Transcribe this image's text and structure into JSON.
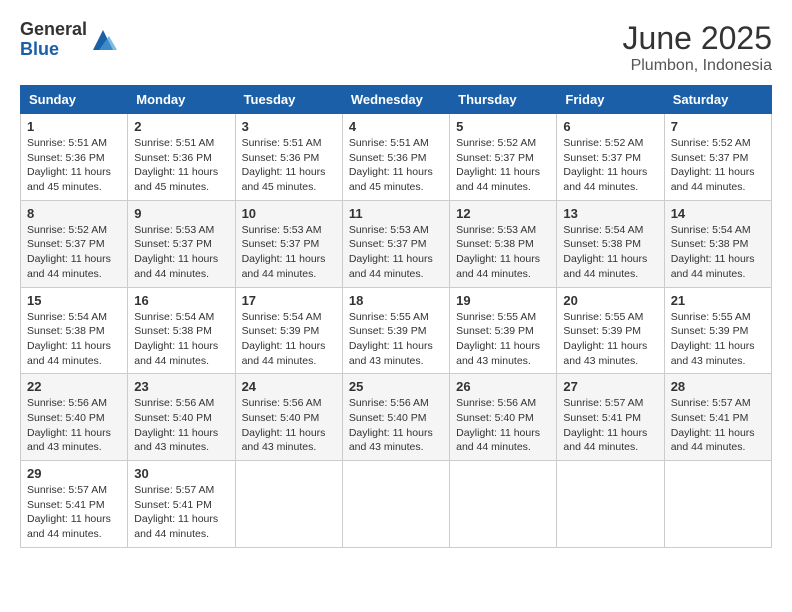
{
  "header": {
    "logo_general": "General",
    "logo_blue": "Blue",
    "month": "June 2025",
    "location": "Plumbon, Indonesia"
  },
  "weekdays": [
    "Sunday",
    "Monday",
    "Tuesday",
    "Wednesday",
    "Thursday",
    "Friday",
    "Saturday"
  ],
  "weeks": [
    [
      {
        "day": "1",
        "sunrise": "5:51 AM",
        "sunset": "5:36 PM",
        "daylight": "11 hours and 45 minutes."
      },
      {
        "day": "2",
        "sunrise": "5:51 AM",
        "sunset": "5:36 PM",
        "daylight": "11 hours and 45 minutes."
      },
      {
        "day": "3",
        "sunrise": "5:51 AM",
        "sunset": "5:36 PM",
        "daylight": "11 hours and 45 minutes."
      },
      {
        "day": "4",
        "sunrise": "5:51 AM",
        "sunset": "5:36 PM",
        "daylight": "11 hours and 45 minutes."
      },
      {
        "day": "5",
        "sunrise": "5:52 AM",
        "sunset": "5:37 PM",
        "daylight": "11 hours and 44 minutes."
      },
      {
        "day": "6",
        "sunrise": "5:52 AM",
        "sunset": "5:37 PM",
        "daylight": "11 hours and 44 minutes."
      },
      {
        "day": "7",
        "sunrise": "5:52 AM",
        "sunset": "5:37 PM",
        "daylight": "11 hours and 44 minutes."
      }
    ],
    [
      {
        "day": "8",
        "sunrise": "5:52 AM",
        "sunset": "5:37 PM",
        "daylight": "11 hours and 44 minutes."
      },
      {
        "day": "9",
        "sunrise": "5:53 AM",
        "sunset": "5:37 PM",
        "daylight": "11 hours and 44 minutes."
      },
      {
        "day": "10",
        "sunrise": "5:53 AM",
        "sunset": "5:37 PM",
        "daylight": "11 hours and 44 minutes."
      },
      {
        "day": "11",
        "sunrise": "5:53 AM",
        "sunset": "5:37 PM",
        "daylight": "11 hours and 44 minutes."
      },
      {
        "day": "12",
        "sunrise": "5:53 AM",
        "sunset": "5:38 PM",
        "daylight": "11 hours and 44 minutes."
      },
      {
        "day": "13",
        "sunrise": "5:54 AM",
        "sunset": "5:38 PM",
        "daylight": "11 hours and 44 minutes."
      },
      {
        "day": "14",
        "sunrise": "5:54 AM",
        "sunset": "5:38 PM",
        "daylight": "11 hours and 44 minutes."
      }
    ],
    [
      {
        "day": "15",
        "sunrise": "5:54 AM",
        "sunset": "5:38 PM",
        "daylight": "11 hours and 44 minutes."
      },
      {
        "day": "16",
        "sunrise": "5:54 AM",
        "sunset": "5:38 PM",
        "daylight": "11 hours and 44 minutes."
      },
      {
        "day": "17",
        "sunrise": "5:54 AM",
        "sunset": "5:39 PM",
        "daylight": "11 hours and 44 minutes."
      },
      {
        "day": "18",
        "sunrise": "5:55 AM",
        "sunset": "5:39 PM",
        "daylight": "11 hours and 43 minutes."
      },
      {
        "day": "19",
        "sunrise": "5:55 AM",
        "sunset": "5:39 PM",
        "daylight": "11 hours and 43 minutes."
      },
      {
        "day": "20",
        "sunrise": "5:55 AM",
        "sunset": "5:39 PM",
        "daylight": "11 hours and 43 minutes."
      },
      {
        "day": "21",
        "sunrise": "5:55 AM",
        "sunset": "5:39 PM",
        "daylight": "11 hours and 43 minutes."
      }
    ],
    [
      {
        "day": "22",
        "sunrise": "5:56 AM",
        "sunset": "5:40 PM",
        "daylight": "11 hours and 43 minutes."
      },
      {
        "day": "23",
        "sunrise": "5:56 AM",
        "sunset": "5:40 PM",
        "daylight": "11 hours and 43 minutes."
      },
      {
        "day": "24",
        "sunrise": "5:56 AM",
        "sunset": "5:40 PM",
        "daylight": "11 hours and 43 minutes."
      },
      {
        "day": "25",
        "sunrise": "5:56 AM",
        "sunset": "5:40 PM",
        "daylight": "11 hours and 43 minutes."
      },
      {
        "day": "26",
        "sunrise": "5:56 AM",
        "sunset": "5:40 PM",
        "daylight": "11 hours and 44 minutes."
      },
      {
        "day": "27",
        "sunrise": "5:57 AM",
        "sunset": "5:41 PM",
        "daylight": "11 hours and 44 minutes."
      },
      {
        "day": "28",
        "sunrise": "5:57 AM",
        "sunset": "5:41 PM",
        "daylight": "11 hours and 44 minutes."
      }
    ],
    [
      {
        "day": "29",
        "sunrise": "5:57 AM",
        "sunset": "5:41 PM",
        "daylight": "11 hours and 44 minutes."
      },
      {
        "day": "30",
        "sunrise": "5:57 AM",
        "sunset": "5:41 PM",
        "daylight": "11 hours and 44 minutes."
      },
      null,
      null,
      null,
      null,
      null
    ]
  ],
  "labels": {
    "sunrise": "Sunrise:",
    "sunset": "Sunset:",
    "daylight": "Daylight:"
  }
}
